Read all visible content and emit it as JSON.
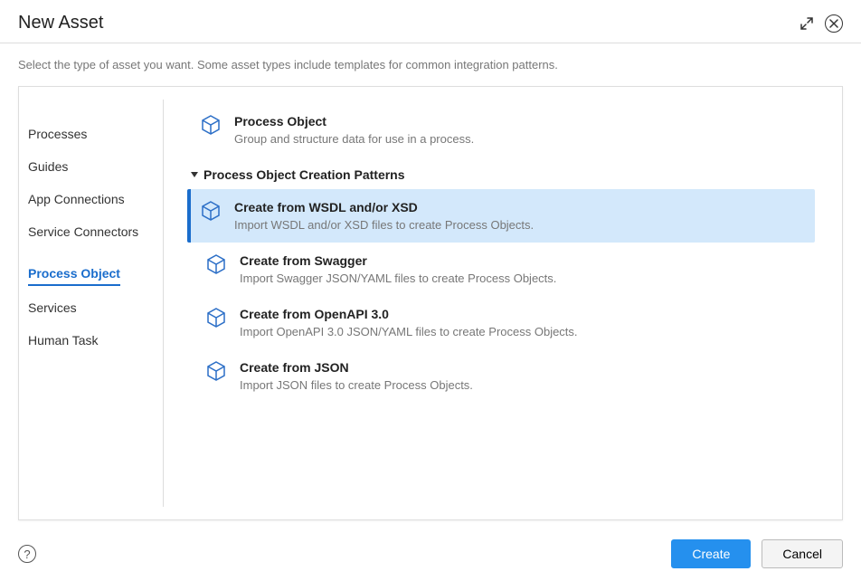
{
  "header": {
    "title": "New Asset"
  },
  "subtitle": "Select the type of asset you want. Some asset types include templates for common integration patterns.",
  "sidebar": {
    "items": [
      {
        "label": "Processes",
        "active": false
      },
      {
        "label": "Guides",
        "active": false
      },
      {
        "label": "App Connections",
        "active": false
      },
      {
        "label": "Service Connectors",
        "active": false
      },
      {
        "label": "Process Object",
        "active": true
      },
      {
        "label": "Services",
        "active": false
      },
      {
        "label": "Human Task",
        "active": false
      }
    ]
  },
  "main": {
    "primary": {
      "title": "Process Object",
      "desc": "Group and structure data for use in a process."
    },
    "section_header": "Process Object Creation Patterns",
    "patterns": [
      {
        "title": "Create from WSDL and/or XSD",
        "desc": "Import WSDL and/or XSD files to create Process Objects.",
        "selected": true
      },
      {
        "title": "Create from Swagger",
        "desc": "Import Swagger JSON/YAML files to create Process Objects.",
        "selected": false
      },
      {
        "title": "Create from OpenAPI 3.0",
        "desc": "Import OpenAPI 3.0 JSON/YAML files to create Process Objects.",
        "selected": false
      },
      {
        "title": "Create from JSON",
        "desc": "Import JSON files to create Process Objects.",
        "selected": false
      }
    ]
  },
  "footer": {
    "help": "?",
    "create": "Create",
    "cancel": "Cancel"
  }
}
